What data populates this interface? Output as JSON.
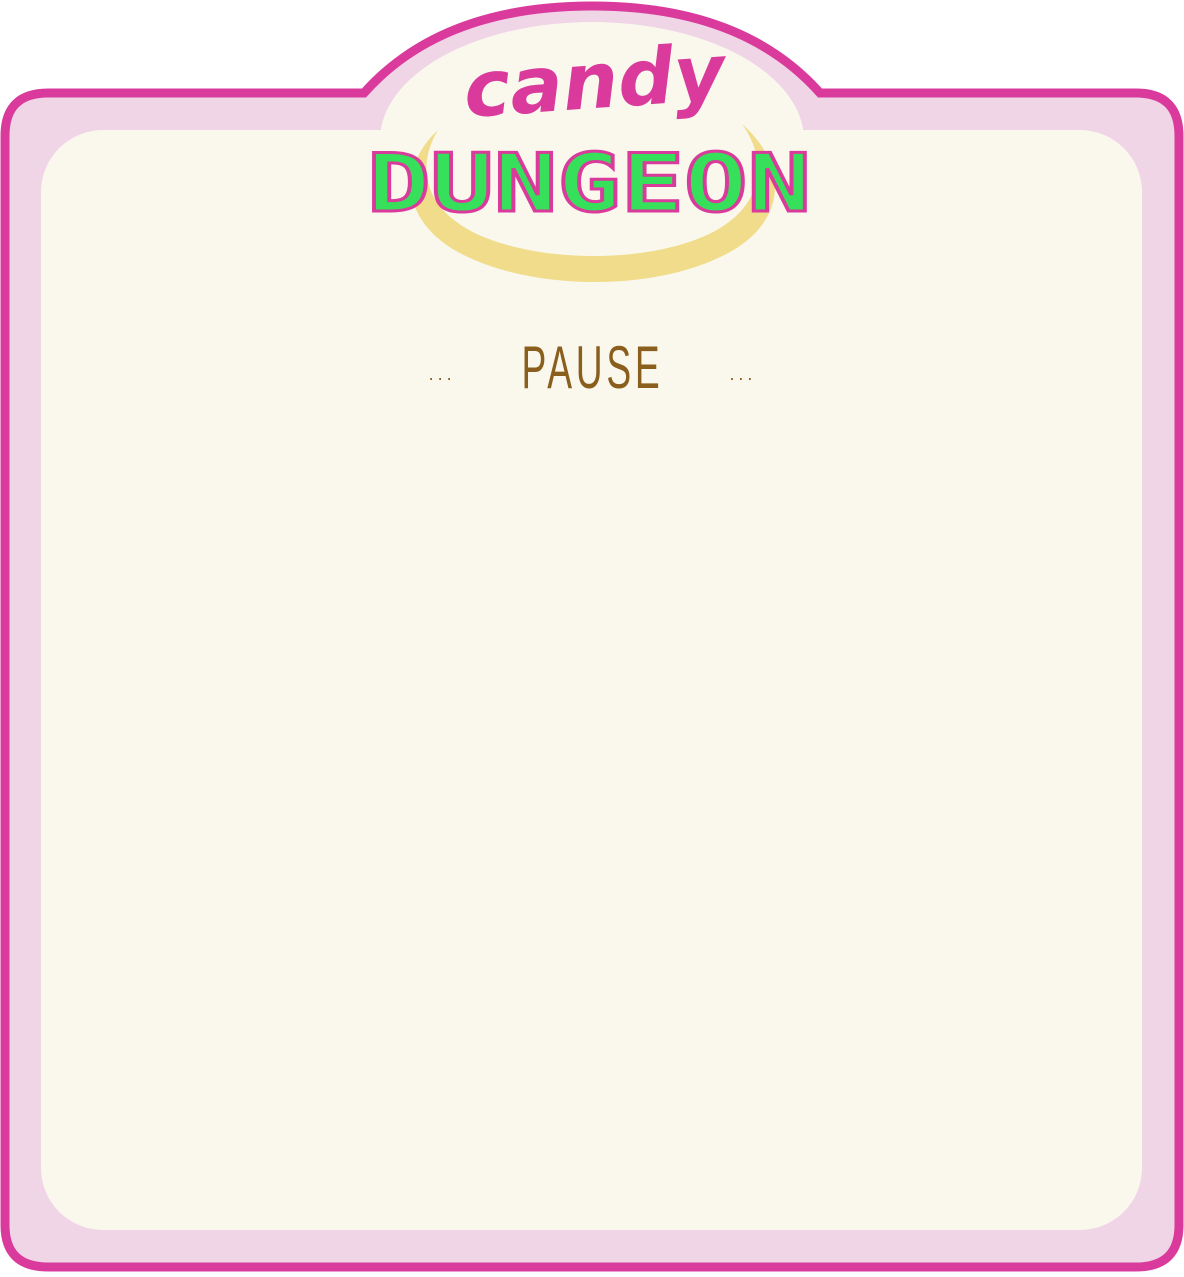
{
  "logo": {
    "line1": "candy",
    "line2": "DUNGEON"
  },
  "pause_screen": {
    "title": "PAUSE",
    "ornament": "···"
  },
  "colors": {
    "frame_outline": "#d93a9c",
    "frame_fill": "#efd5e6",
    "panel_fill": "#faf8ed",
    "halo": "#f0dc8a",
    "logo_pink": "#d93a9c",
    "logo_green": "#36e05a",
    "title_brown": "#8a5f1e"
  }
}
